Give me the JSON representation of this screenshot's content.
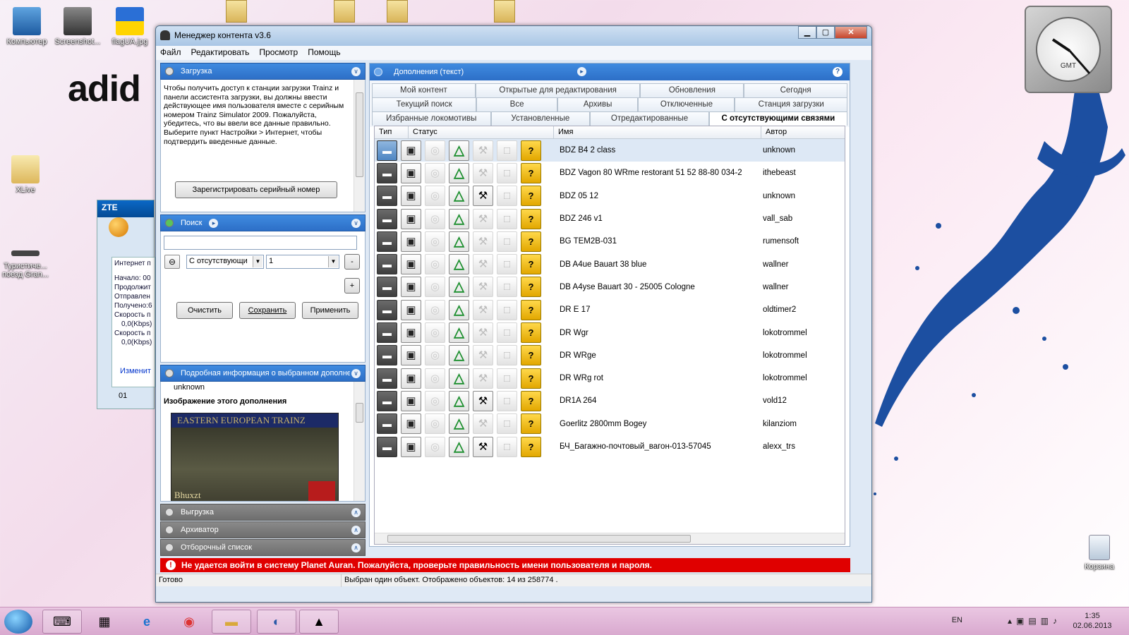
{
  "desktop": {
    "brand_text": "adid",
    "icons": [
      {
        "label": "Компьютер"
      },
      {
        "label": "Screenshot..."
      },
      {
        "label": "flagUA.jpg"
      },
      {
        "label": "XLive"
      },
      {
        "label": "Туристиче... поезд Gran..."
      },
      {
        "label": "Корзина"
      }
    ],
    "clock_label": "GMT"
  },
  "zte": {
    "title": "ZTE",
    "lines": [
      "Интернет п",
      "Начало: 00",
      "Продолжит",
      "Отправлен",
      "Получено:6",
      "Скорость п",
      "0,0(Kbps)",
      "Скорость п",
      "0,0(Kbps)"
    ],
    "change_link": "Изменит",
    "footer": "01"
  },
  "window": {
    "title": "Менеджер контента v3.6",
    "menu": [
      "Файл",
      "Редактировать",
      "Просмотр",
      "Помощь"
    ],
    "download_panel": {
      "title": "Загрузка",
      "text": "Чтобы получить доступ к станции загрузки Trainz и панели ассистента загрузки, вы должны ввести действующее имя пользователя вместе с серийным номером Trainz Simulator 2009. Пожалуйста, убедитесь, что вы ввели все данные правильно. Выберите пункт Настройки > Интернет, чтобы подтвердить введенные данные.",
      "register_button": "Зарегистрировать серийный номер"
    },
    "search_panel": {
      "title": "Поиск",
      "query": "",
      "filter_value": "С отсутствующи",
      "filter_arg": "1",
      "minus_label": "-",
      "plus_label": "+",
      "clear_button": "Очистить",
      "save_button": "Сохранить",
      "apply_button": "Применить"
    },
    "details_panel": {
      "title": "Подробная информация о выбранном дополнении",
      "author_value": "unknown",
      "image_heading": "Изображение этого дополнения",
      "image_caption_top": "EASTERN EUROPEAN TRAINZ",
      "image_caption_bottom": "Bhuxzt"
    },
    "collapsed_panels": [
      "Выгрузка",
      "Архиватор",
      "Отборочный список"
    ],
    "main_panel": {
      "title": "Дополнения (текст)",
      "help_label": "?",
      "tabs_row1": [
        "Мой контент",
        "Открытые для редактирования",
        "Обновления",
        "Сегодня"
      ],
      "tabs_row2": [
        "Текущий поиск",
        "Все",
        "Архивы",
        "Отключенные",
        "Станция загрузки"
      ],
      "tabs_row3": [
        "Избранные локомотивы",
        "Установленные",
        "Отредактированные",
        "С отсутствующими связями"
      ],
      "active_tab": "С отсутствующими связями",
      "columns": [
        "Тип",
        "Статус",
        "Имя",
        "Автор"
      ],
      "rows": [
        {
          "name": "BDZ B4 2 class",
          "author": "unknown",
          "tool": false,
          "selected": true
        },
        {
          "name": "BDZ Vagon 80 WRme restorant 51 52 88-80 034-2",
          "author": "ithebeast",
          "tool": false,
          "selected": false
        },
        {
          "name": "BDZ 05 12",
          "author": "unknown",
          "tool": true,
          "selected": false
        },
        {
          "name": "BDZ 246 v1",
          "author": "vall_sab",
          "tool": false,
          "selected": false
        },
        {
          "name": "BG TEM2B-031",
          "author": "rumensoft",
          "tool": false,
          "selected": false
        },
        {
          "name": "DB A4ue Bauart 38 blue",
          "author": "wallner",
          "tool": false,
          "selected": false
        },
        {
          "name": "DB A4yse Bauart 30 - 25005 Cologne",
          "author": "wallner",
          "tool": false,
          "selected": false
        },
        {
          "name": "DR E 17",
          "author": "oldtimer2",
          "tool": false,
          "selected": false
        },
        {
          "name": "DR Wgr",
          "author": "lokotrommel",
          "tool": false,
          "selected": false
        },
        {
          "name": "DR WRge",
          "author": "lokotrommel",
          "tool": false,
          "selected": false
        },
        {
          "name": "DR WRg rot",
          "author": "lokotrommel",
          "tool": false,
          "selected": false
        },
        {
          "name": "DR1A 264",
          "author": "vold12",
          "tool": true,
          "selected": false
        },
        {
          "name": "Goerlitz 2800mm Bogey",
          "author": "kilanziom",
          "tool": false,
          "selected": false
        },
        {
          "name": "БЧ_Багажно-почтовый_вагон-013-57045",
          "author": "alexx_trs",
          "tool": true,
          "selected": false
        }
      ]
    },
    "error_message": "Не удается войти в систему Planet Auran. Пожалуйста, проверьте правильность имени пользователя и пароля.",
    "status_left": "Готово",
    "status_right": "Выбран один объект. Отображено объектов: 14 из 258774 ."
  },
  "taskbar": {
    "language": "EN",
    "time": "1:35",
    "date": "02.06.2013"
  }
}
